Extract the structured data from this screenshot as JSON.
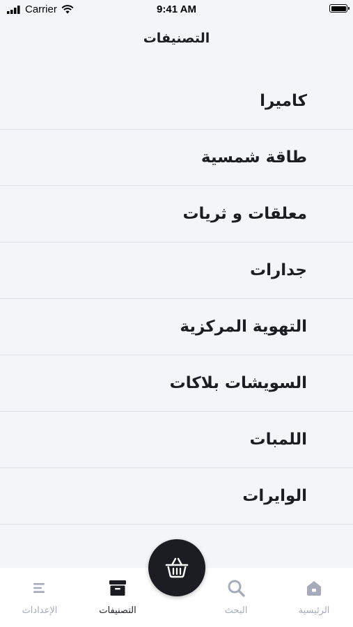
{
  "status_bar": {
    "carrier": "Carrier",
    "time": "9:41 AM"
  },
  "header": {
    "title": "التصنيفات"
  },
  "categories": [
    {
      "label": "كاميرا"
    },
    {
      "label": "طاقة شمسية"
    },
    {
      "label": "معلقات و ثريات"
    },
    {
      "label": "جدارات"
    },
    {
      "label": "التهوية المركزية"
    },
    {
      "label": "السويشات بلاكات"
    },
    {
      "label": "اللمبات"
    },
    {
      "label": "الوايرات"
    }
  ],
  "tab_bar": {
    "settings": {
      "label": "الإعدادات",
      "icon": "menu-icon"
    },
    "categories": {
      "label": "التصنيفات",
      "icon": "archive-icon"
    },
    "search": {
      "label": "البحث",
      "icon": "search-icon"
    },
    "home": {
      "label": "الرئيسية",
      "icon": "home-icon"
    }
  },
  "fab": {
    "icon": "basket-icon"
  },
  "colors": {
    "background": "#f3f5f8",
    "accent": "#1c1d22",
    "inactive": "#a7abb9",
    "divider": "#dde1e7"
  }
}
